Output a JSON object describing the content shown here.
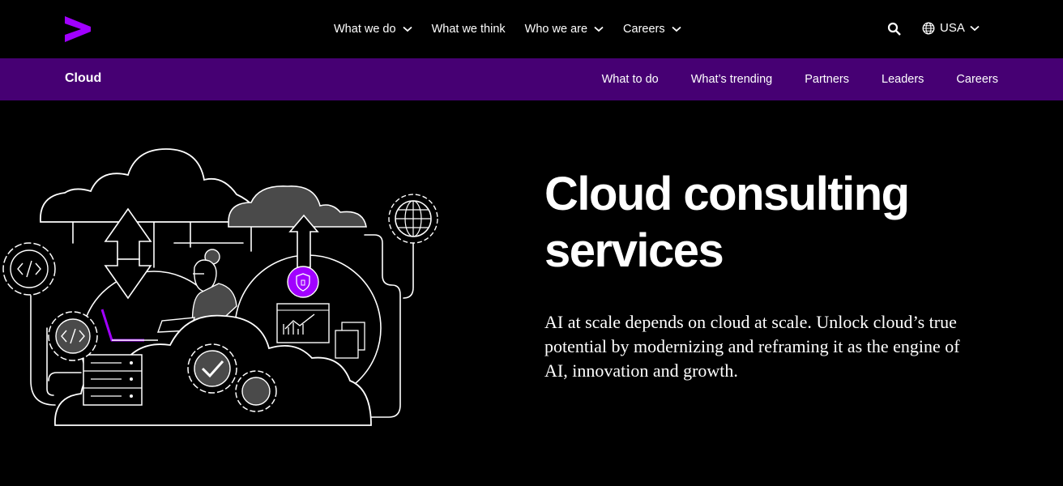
{
  "header": {
    "logo_icon": "accenture-greater-than-logo",
    "menu": [
      {
        "label": "What we do",
        "has_dropdown": true
      },
      {
        "label": "What we think",
        "has_dropdown": false
      },
      {
        "label": "Who we are",
        "has_dropdown": true
      },
      {
        "label": "Careers",
        "has_dropdown": true
      }
    ],
    "search_icon": "search-icon",
    "locale": {
      "label": "USA",
      "icon": "globe-icon"
    }
  },
  "subnav": {
    "title": "Cloud",
    "links": [
      "What to do",
      "What’s trending",
      "Partners",
      "Leaders",
      "Careers"
    ]
  },
  "hero": {
    "title_line1": "Cloud consulting",
    "title_line2": "services",
    "description": "AI at scale depends on cloud at scale. Unlock cloud’s true potential by modernizing and reframing it as the engine of AI, innovation and growth."
  },
  "colors": {
    "background": "#000000",
    "brand_purple": "#A100FF",
    "subnav_purple": "#460073",
    "text": "#FFFFFF"
  }
}
